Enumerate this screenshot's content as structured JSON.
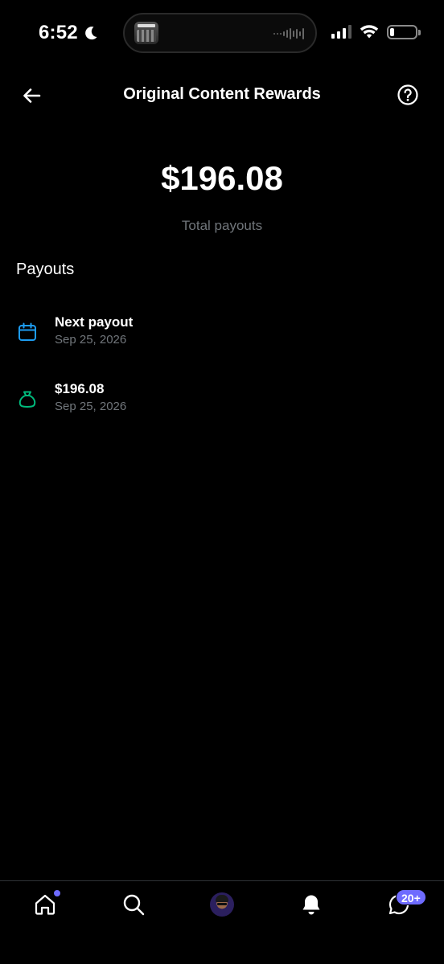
{
  "status_bar": {
    "time": "6:52",
    "icons": [
      "moon-icon",
      "cellular-signal-icon",
      "wifi-icon",
      "battery-icon"
    ]
  },
  "header": {
    "title": "Original Content Rewards",
    "back_icon": "arrow-left-icon",
    "help_icon": "question-circle-icon"
  },
  "summary": {
    "total_amount": "$196.08",
    "total_label": "Total payouts"
  },
  "payouts": {
    "section_title": "Payouts",
    "items": [
      {
        "icon": "calendar-icon",
        "icon_color": "#1d9bf0",
        "primary": "Next payout",
        "secondary": "Sep 25, 2026"
      },
      {
        "icon": "money-bag-icon",
        "icon_color": "#00ba7c",
        "primary": "$196.08",
        "secondary": "Sep 25, 2026"
      }
    ]
  },
  "bottom_nav": {
    "items": [
      "home-icon",
      "search-icon",
      "avatar",
      "bell-icon",
      "messages-icon"
    ],
    "messages_badge": "20+",
    "accent_color": "#6e6bff"
  }
}
